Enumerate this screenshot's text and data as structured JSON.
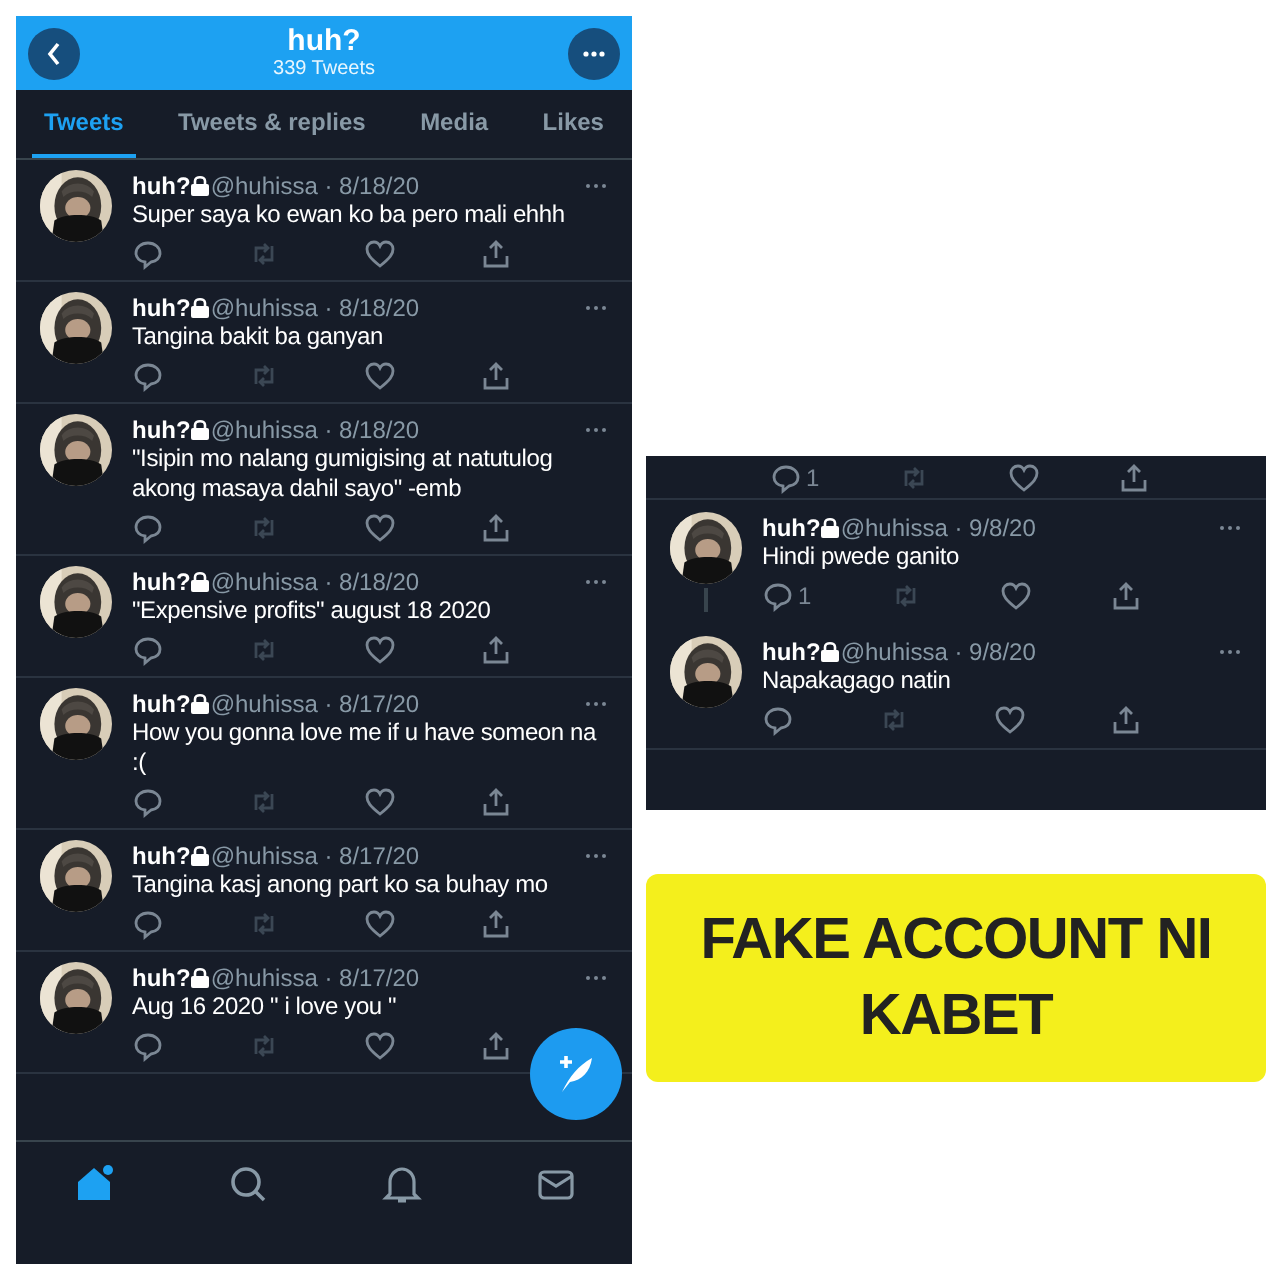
{
  "profile_header": {
    "name": "huh?",
    "tweet_count": "339 Tweets"
  },
  "tabs": [
    {
      "label": "Tweets",
      "selected": true
    },
    {
      "label": "Tweets & replies",
      "selected": false
    },
    {
      "label": "Media",
      "selected": false
    },
    {
      "label": "Likes",
      "selected": false
    }
  ],
  "timeline": [
    {
      "name": "huh?",
      "meta": "@huhissa · 8/18/20",
      "text": "Super saya ko ewan ko ba pero mali ehhh"
    },
    {
      "name": "huh?",
      "meta": "@huhissa · 8/18/20",
      "text": "Tangina bakit ba ganyan"
    },
    {
      "name": "huh?",
      "meta": "@huhissa · 8/18/20",
      "text": "\"Isipin mo nalang gumigising at natutulog akong masaya dahil sayo\" -emb"
    },
    {
      "name": "huh?",
      "meta": "@huhissa · 8/18/20",
      "text": "\"Expensive profits\" august 18 2020"
    },
    {
      "name": "huh?",
      "meta": "@huhissa · 8/17/20",
      "text": "How you gonna love me if u have someon na :("
    },
    {
      "name": "huh?",
      "meta": "@huhissa · 8/17/20",
      "text": "Tangina kasj anong part ko sa buhay mo"
    },
    {
      "name": "huh?",
      "meta": "@huhissa · 8/17/20",
      "text": "Aug 16 2020 \" i love you \""
    }
  ],
  "bottom_nav": [
    {
      "kind": "home",
      "selected": true
    },
    {
      "kind": "search",
      "selected": false
    },
    {
      "kind": "notifications",
      "selected": false
    },
    {
      "kind": "messages",
      "selected": false
    }
  ],
  "thread_snippet": {
    "top_reply_count": "1",
    "tweets": [
      {
        "name": "huh?",
        "meta": "@huhissa · 9/8/20",
        "text": "Hindi pwede ganito",
        "reply_count": "1"
      },
      {
        "name": "huh?",
        "meta": "@huhissa · 9/8/20",
        "text": "Napakagago natin"
      }
    ]
  },
  "caption": {
    "lines": [
      "FAKE ACCOUNT NI",
      "KABET"
    ]
  }
}
